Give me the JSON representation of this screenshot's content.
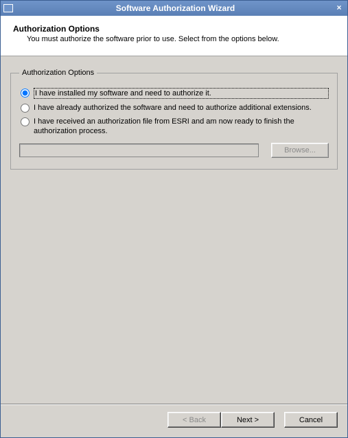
{
  "window": {
    "title": "Software Authorization Wizard",
    "close_label": "×"
  },
  "header": {
    "title": "Authorization Options",
    "subtitle": "You must authorize the software prior to use. Select from the options below."
  },
  "group": {
    "legend": "Authorization Options",
    "options": [
      {
        "label": "I have installed my software and need to authorize it.",
        "selected": true
      },
      {
        "label": "I have already authorized the software and need to authorize additional extensions.",
        "selected": false
      },
      {
        "label": "I have received an authorization file from ESRI and am now ready to finish the authorization process.",
        "selected": false
      }
    ],
    "path_value": "",
    "browse_label": "Browse...",
    "browse_enabled": false
  },
  "footer": {
    "back_label": "< Back",
    "back_enabled": false,
    "next_label": "Next >",
    "cancel_label": "Cancel"
  }
}
